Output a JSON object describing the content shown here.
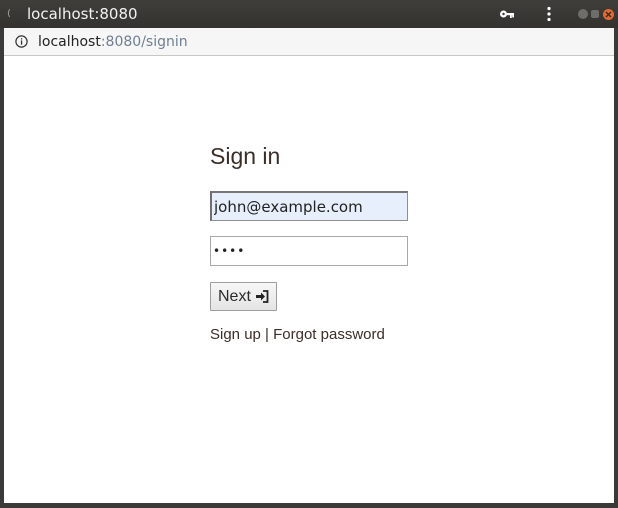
{
  "window": {
    "title": "localhost:8080",
    "controls": [
      "key-icon",
      "menu-icon",
      "minimize",
      "maximize",
      "close"
    ]
  },
  "address_bar": {
    "icon": "info-icon",
    "url_host": "localhost",
    "url_path": ":8080/signin"
  },
  "signin": {
    "heading": "Sign in",
    "email_value": "john@example.com",
    "password_value": "••••",
    "next_label": "Next",
    "next_icon": "sign-in-icon",
    "signup_label": "Sign up",
    "separator": "|",
    "forgot_label": "Forgot password"
  },
  "colors": {
    "titlebar": "#3a3a38",
    "close_button": "#e4692e",
    "autofill_background": "#e8effc",
    "text": "#3b2e28"
  }
}
